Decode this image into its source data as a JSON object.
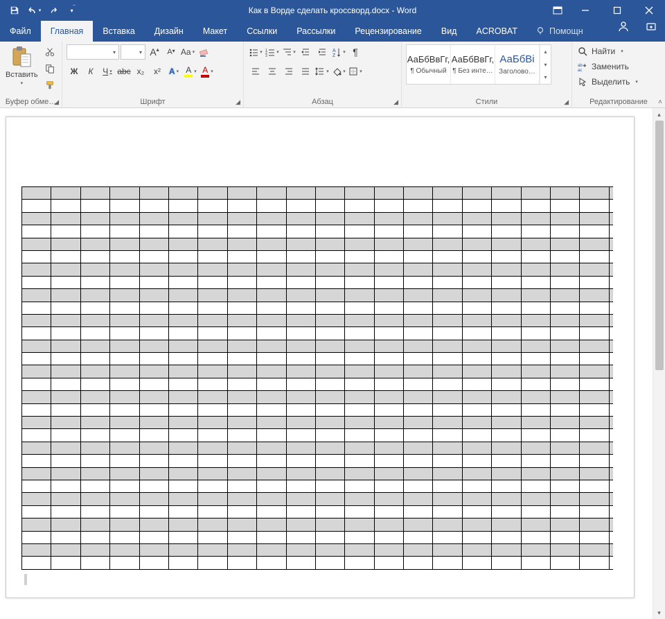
{
  "title": "Как в Ворде сделать кроссворд.docx - Word",
  "tabs": {
    "file": "Файл",
    "home": "Главная",
    "insert": "Вставка",
    "design": "Дизайн",
    "layout": "Макет",
    "references": "Ссылки",
    "mailings": "Рассылки",
    "review": "Рецензирование",
    "view": "Вид",
    "acrobat": "ACROBAT",
    "tellme": "Помощн"
  },
  "groups": {
    "clipboard": "Буфер обме…",
    "font": "Шрифт",
    "paragraph": "Абзац",
    "styles": "Стили",
    "editing": "Редактирование"
  },
  "clipboard": {
    "paste": "Вставить"
  },
  "font": {
    "name": "",
    "size": "",
    "bold": "Ж",
    "italic": "К",
    "underline": "Ч",
    "strike": "abc",
    "sub": "x₂",
    "sup": "x²",
    "caseAa": "Aa",
    "textfx": "A",
    "highlight": "A",
    "color": "A"
  },
  "styles": {
    "sample": "АаБбВвГг,",
    "normal": "¶ Обычный",
    "nospacing": "¶ Без инте…",
    "heading_sample": "АаБбВі",
    "heading1": "Заголово…"
  },
  "editing": {
    "find": "Найти",
    "replace": "Заменить",
    "select": "Выделить"
  },
  "document": {
    "grid": {
      "rows": 30,
      "cols": 20,
      "shadeEveryOtherStartingAt": 0
    }
  }
}
